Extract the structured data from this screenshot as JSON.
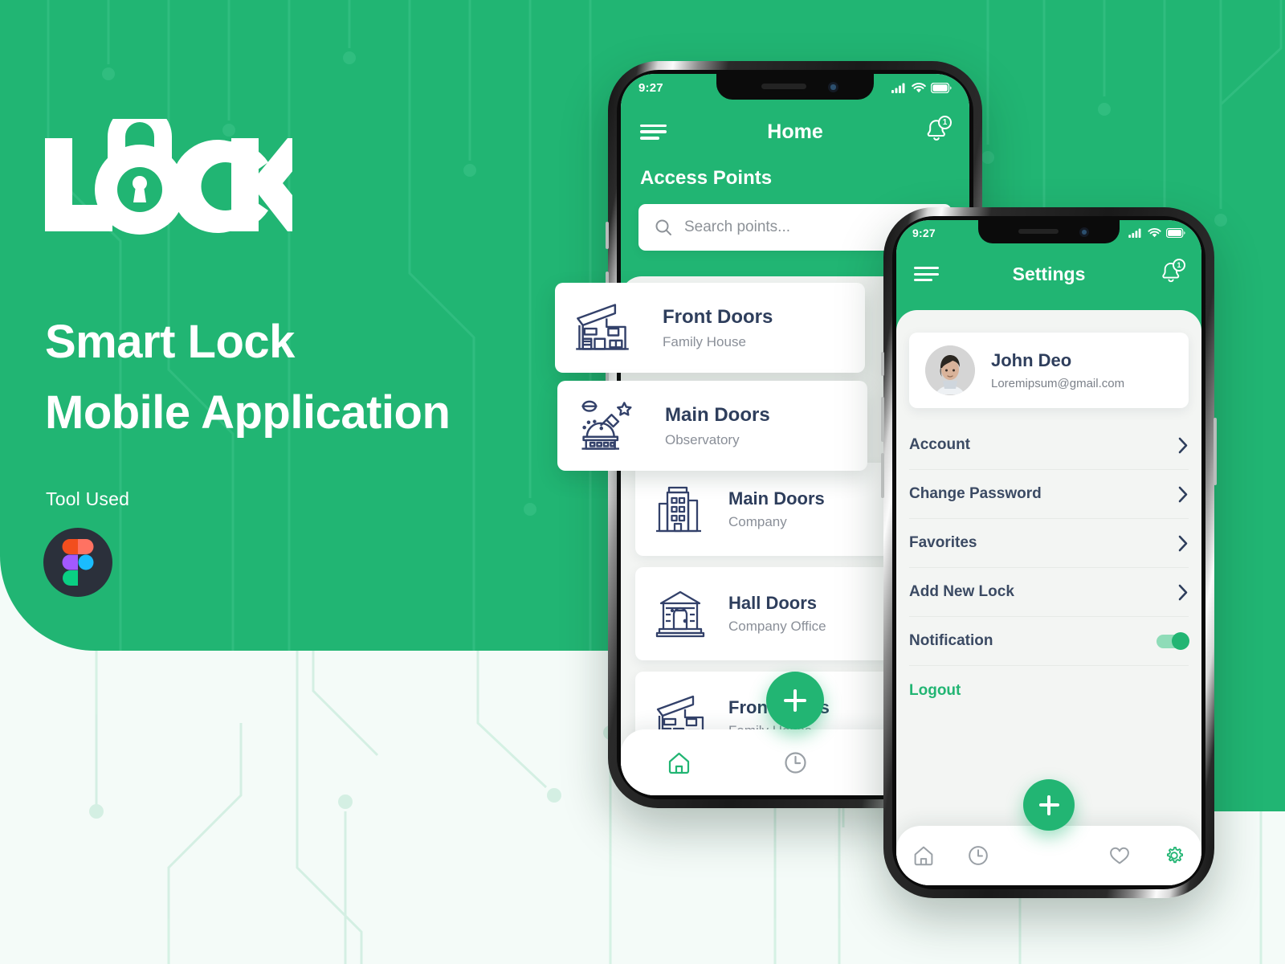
{
  "brand": {
    "logo_text": "LOCK",
    "logo_icon": "padlock-icon",
    "accent_green": "#21b573",
    "dark_navy": "#2e3e5c"
  },
  "hero": {
    "headline_line1": "Smart Lock",
    "headline_line2": "Mobile Application",
    "tool_used_label": "Tool Used",
    "tool_icon": "figma-logo-icon"
  },
  "phone_home": {
    "status": {
      "time": "9:27",
      "signal_icon": "cellular-signal-icon",
      "wifi_icon": "wifi-icon",
      "battery_icon": "battery-icon"
    },
    "appbar": {
      "menu_icon": "hamburger-menu-icon",
      "title": "Home",
      "bell_icon": "notification-bell-icon",
      "badge": "1"
    },
    "section_title": "Access Points",
    "search": {
      "icon": "search-icon",
      "placeholder": "Search points...",
      "value": ""
    },
    "floating_cards": [
      {
        "title": "Front Doors",
        "subtitle": "Family House",
        "icon": "modern-house-icon"
      },
      {
        "title": "Main Doors",
        "subtitle": "Observatory",
        "icon": "observatory-icon"
      }
    ],
    "list": [
      {
        "title": "Main Doors",
        "subtitle": "Company",
        "icon": "office-building-icon"
      },
      {
        "title": "Hall Doors",
        "subtitle": "Company Office",
        "icon": "classic-hall-icon"
      },
      {
        "title": "Front Doors",
        "subtitle": "Family House",
        "icon": "modern-house-icon"
      }
    ],
    "fab": {
      "icon": "plus-icon",
      "label": "+"
    },
    "tabs": [
      {
        "name": "home",
        "icon": "home-icon",
        "active": true
      },
      {
        "name": "history",
        "icon": "clock-icon",
        "active": false
      },
      {
        "name": "favorites",
        "icon": "heart-icon",
        "active": false
      }
    ]
  },
  "phone_settings": {
    "status": {
      "time": "9:27",
      "signal_icon": "cellular-signal-icon",
      "wifi_icon": "wifi-icon",
      "battery_icon": "battery-icon"
    },
    "appbar": {
      "menu_icon": "hamburger-menu-icon",
      "title": "Settings",
      "bell_icon": "notification-bell-icon",
      "badge": "1"
    },
    "profile": {
      "name": "John Deo",
      "email": "Loremipsum@gmail.com",
      "avatar_icon": "user-avatar-photo"
    },
    "menu": [
      {
        "label": "Account",
        "control": "chevron",
        "accent": false
      },
      {
        "label": "Change Password",
        "control": "chevron",
        "accent": false
      },
      {
        "label": "Favorites",
        "control": "chevron",
        "accent": false
      },
      {
        "label": "Add New Lock",
        "control": "chevron",
        "accent": false
      },
      {
        "label": "Notification",
        "control": "toggle",
        "toggle_on": true,
        "accent": false
      },
      {
        "label": "Logout",
        "control": "none",
        "accent": true
      }
    ],
    "fab": {
      "icon": "plus-icon",
      "label": "+"
    },
    "tabs": [
      {
        "name": "home",
        "icon": "home-icon",
        "active": false
      },
      {
        "name": "history",
        "icon": "clock-icon",
        "active": false
      },
      {
        "name": "favorites",
        "icon": "heart-icon",
        "active": false
      },
      {
        "name": "settings",
        "icon": "gear-icon",
        "active": true
      }
    ]
  }
}
